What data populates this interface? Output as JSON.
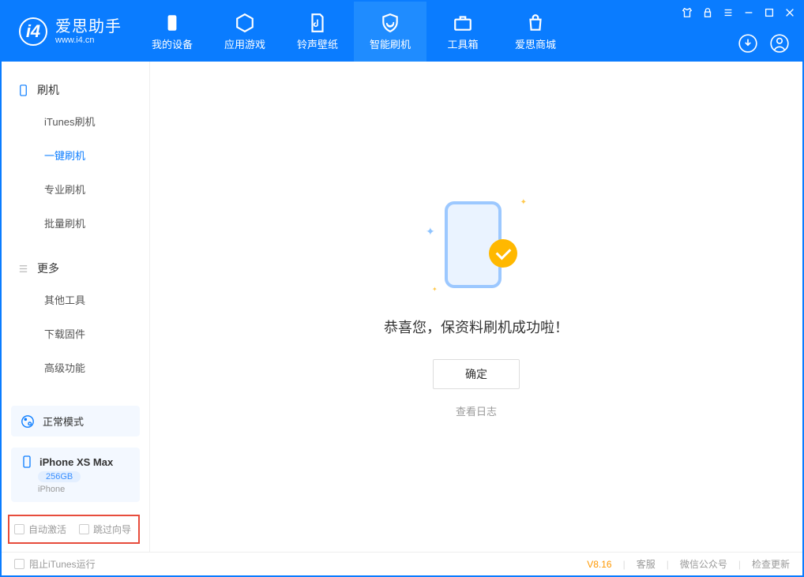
{
  "app": {
    "name": "爱思助手",
    "url": "www.i4.cn"
  },
  "nav": {
    "tabs": [
      {
        "label": "我的设备"
      },
      {
        "label": "应用游戏"
      },
      {
        "label": "铃声壁纸"
      },
      {
        "label": "智能刷机"
      },
      {
        "label": "工具箱"
      },
      {
        "label": "爱思商城"
      }
    ]
  },
  "sidebar": {
    "section1": {
      "title": "刷机",
      "items": [
        "iTunes刷机",
        "一键刷机",
        "专业刷机",
        "批量刷机"
      ]
    },
    "section2": {
      "title": "更多",
      "items": [
        "其他工具",
        "下载固件",
        "高级功能"
      ]
    },
    "mode": "正常模式",
    "device": {
      "name": "iPhone XS Max",
      "storage": "256GB",
      "type": "iPhone"
    },
    "checks": {
      "auto_activate": "自动激活",
      "skip_guide": "跳过向导"
    }
  },
  "main": {
    "success_msg": "恭喜您，保资料刷机成功啦！",
    "ok_label": "确定",
    "log_link": "查看日志"
  },
  "footer": {
    "block_itunes": "阻止iTunes运行",
    "version": "V8.16",
    "links": [
      "客服",
      "微信公众号",
      "检查更新"
    ]
  }
}
